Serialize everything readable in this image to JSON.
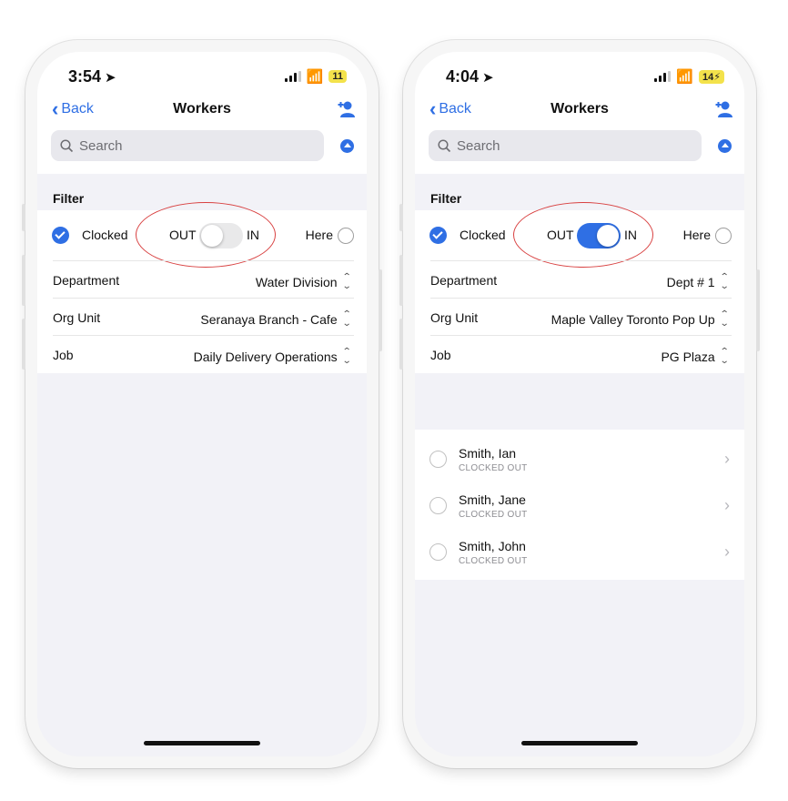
{
  "phones": [
    {
      "status_time": "3:54",
      "battery": "11",
      "nav": {
        "back": "Back",
        "title": "Workers"
      },
      "search_placeholder": "Search",
      "filter_label": "Filter",
      "clocked": {
        "label": "Clocked",
        "out": "OUT",
        "in": "IN",
        "state": "out",
        "here": "Here"
      },
      "rows": [
        {
          "label": "Department",
          "value": "Water Division"
        },
        {
          "label": "Org Unit",
          "value": "Seranaya Branch - Cafe"
        },
        {
          "label": "Job",
          "value": "Daily Delivery Operations"
        }
      ],
      "workers": []
    },
    {
      "status_time": "4:04",
      "battery": "14",
      "nav": {
        "back": "Back",
        "title": "Workers"
      },
      "search_placeholder": "Search",
      "filter_label": "Filter",
      "clocked": {
        "label": "Clocked",
        "out": "OUT",
        "in": "IN",
        "state": "in",
        "here": "Here"
      },
      "rows": [
        {
          "label": "Department",
          "value": "Dept # 1"
        },
        {
          "label": "Org Unit",
          "value": "Maple Valley Toronto Pop Up"
        },
        {
          "label": "Job",
          "value": "PG Plaza"
        }
      ],
      "workers": [
        {
          "name": "Smith, Ian",
          "status": "CLOCKED OUT"
        },
        {
          "name": "Smith, Jane",
          "status": "CLOCKED OUT"
        },
        {
          "name": "Smith, John",
          "status": "CLOCKED OUT"
        }
      ]
    }
  ],
  "colors": {
    "accent": "#2f6fe4",
    "annotation": "#d84040",
    "battery": "#f3e24b"
  }
}
